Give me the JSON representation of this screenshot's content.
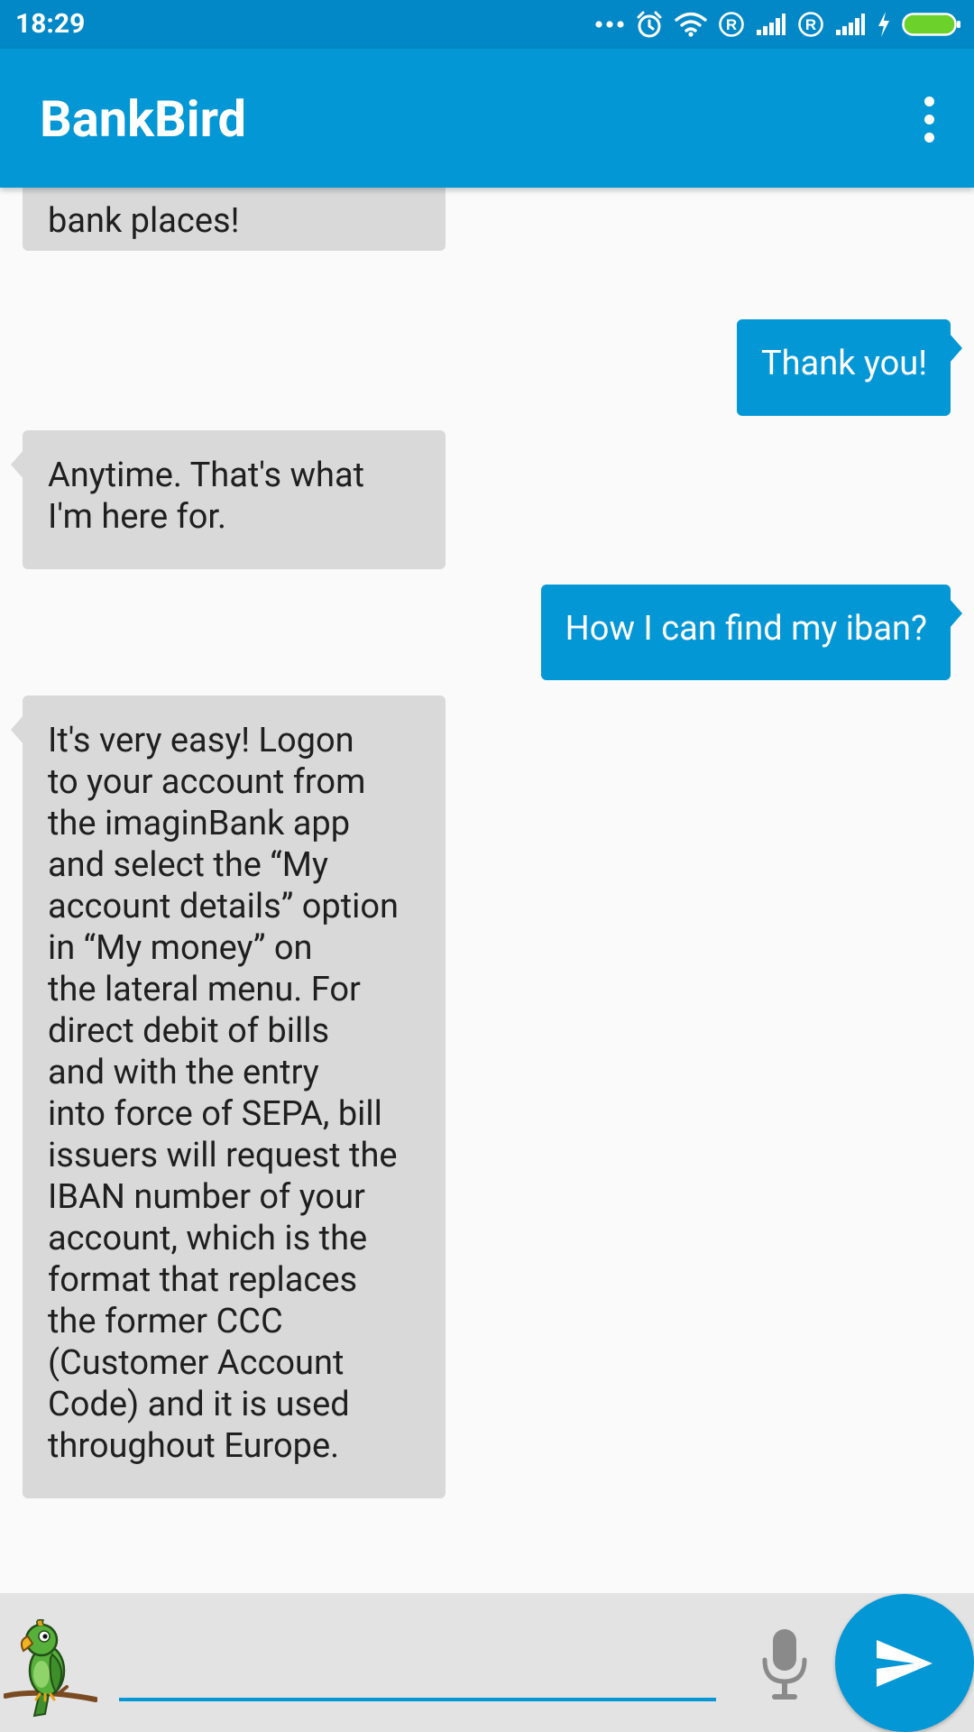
{
  "status_bar": {
    "time": "18:29"
  },
  "app_bar": {
    "title": "BankBird"
  },
  "messages": [
    {
      "sender": "bot",
      "text": "bank places!"
    },
    {
      "sender": "user",
      "text": "Thank you!"
    },
    {
      "sender": "bot",
      "text": "Anytime. That's what\nI'm here for."
    },
    {
      "sender": "user",
      "text": "How I can find my iban?"
    },
    {
      "sender": "bot",
      "text": "It's very easy! Logon\nto your account from\nthe imaginBank app\nand select the “My\naccount details” option\nin “My money” on\nthe lateral menu. For\ndirect debit of bills\nand with the entry\ninto force of SEPA, bill\nissuers will request the\nIBAN number of your\naccount, which is the\nformat that replaces\nthe former CCC\n(Customer Account\nCode) and it is used\nthroughout Europe."
    }
  ],
  "input": {
    "value": "",
    "placeholder": ""
  },
  "icons": {
    "menu": "overflow-menu-icon",
    "mic": "microphone-icon",
    "send": "send-icon",
    "mascot": "parrot-mascot-icon"
  },
  "colors": {
    "status_bar": "#0288c6",
    "primary": "#0397d6",
    "bot_bubble": "#d9d9d9",
    "background": "#fafafa",
    "input_bar": "#e3e3e3"
  }
}
